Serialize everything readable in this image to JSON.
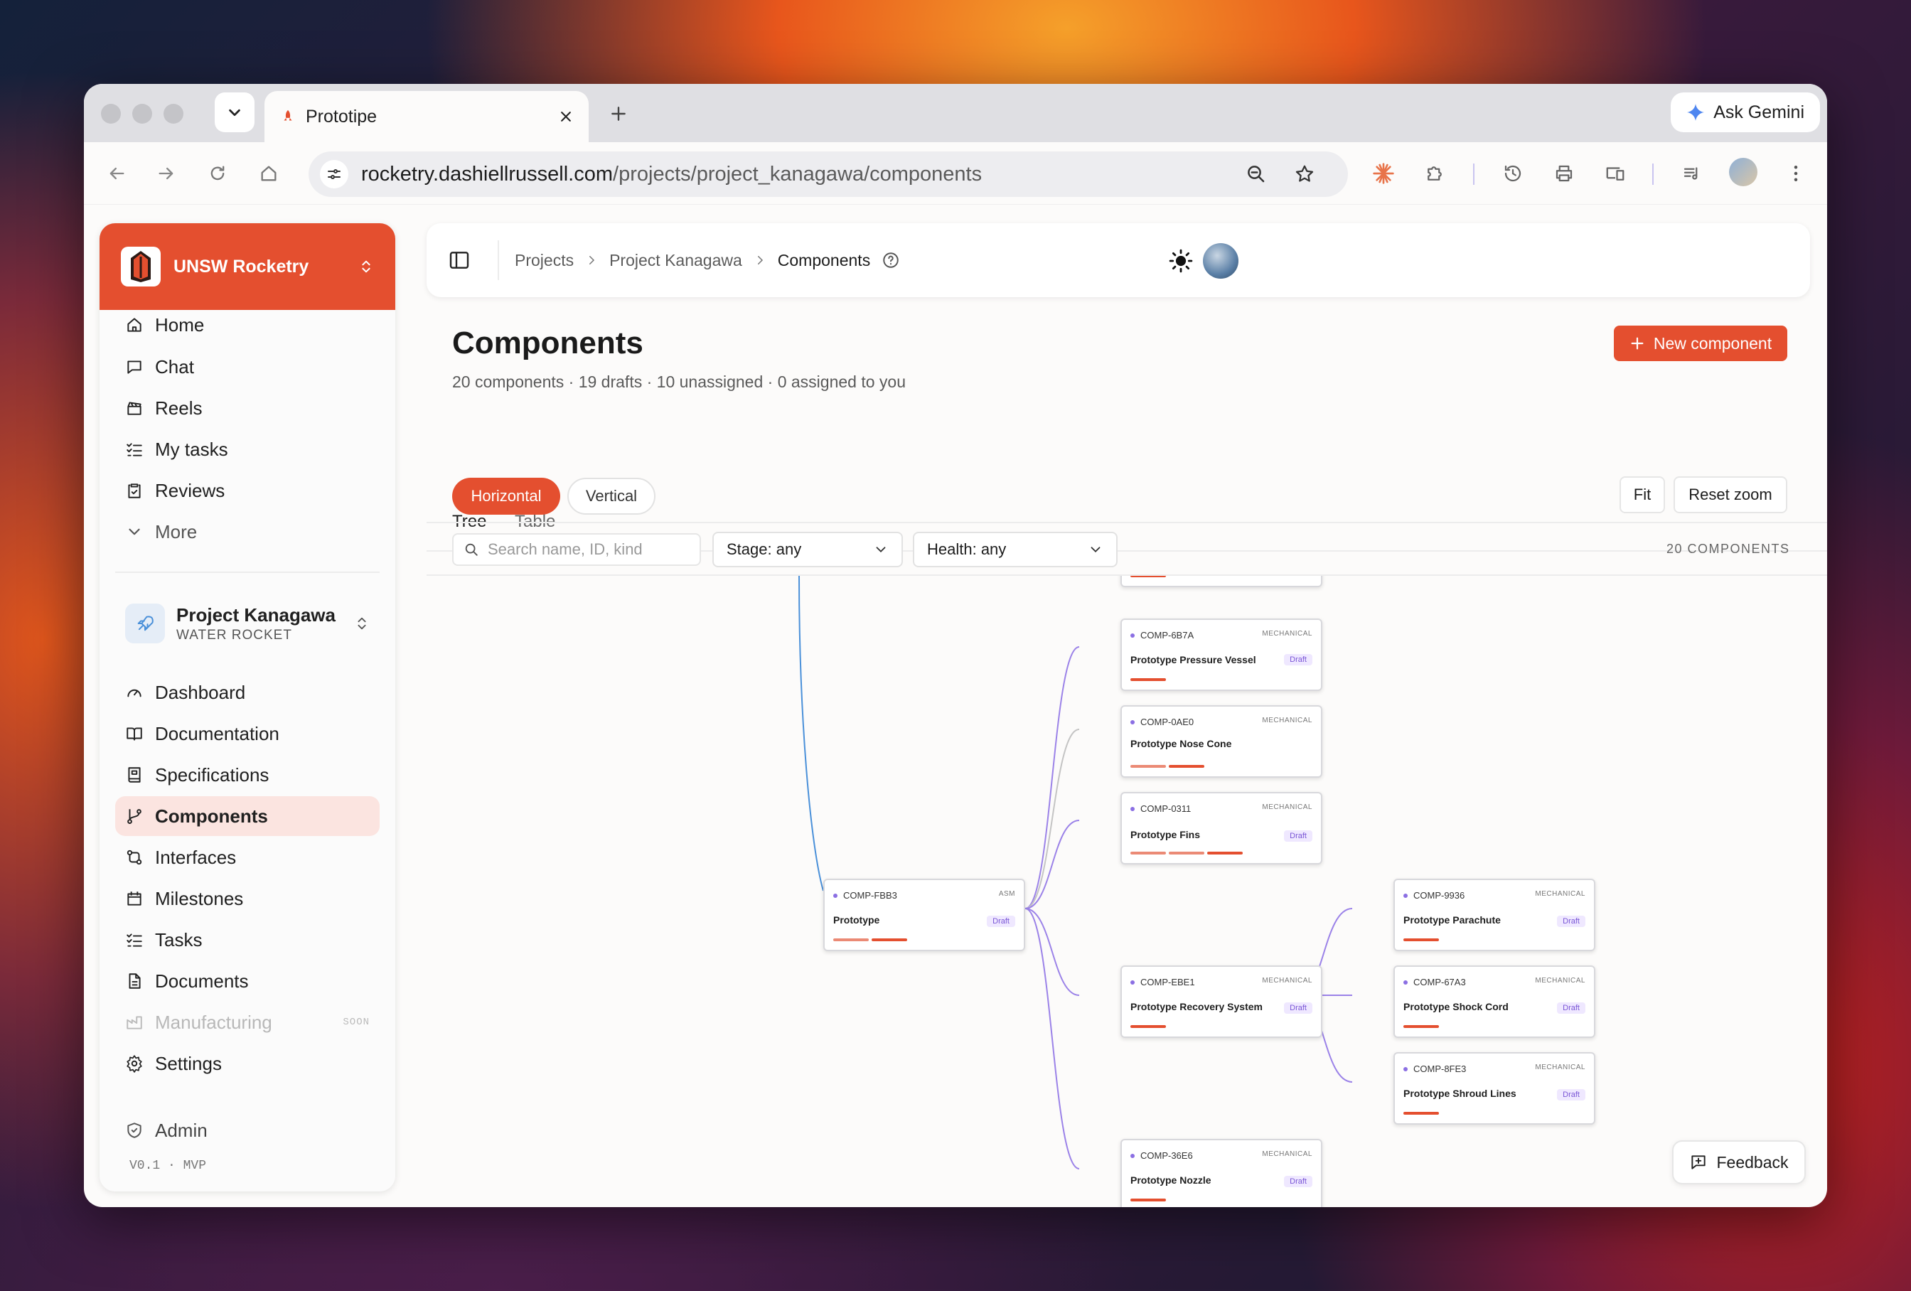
{
  "browser": {
    "tab_title": "Prototipe",
    "ask_gemini": "Ask Gemini",
    "url_host": "rocketry.dashiellrussell.com",
    "url_path": "/projects/project_kanagawa/components"
  },
  "sidebar": {
    "org_name": "UNSW Rocketry",
    "top_items": [
      {
        "label": "Home",
        "icon": "home-icon"
      },
      {
        "label": "Chat",
        "icon": "chat-icon"
      },
      {
        "label": "Reels",
        "icon": "clapperboard-icon"
      },
      {
        "label": "My tasks",
        "icon": "checklist-icon"
      },
      {
        "label": "Reviews",
        "icon": "clipboard-check-icon"
      },
      {
        "label": "More",
        "icon": "chevron-down-icon"
      }
    ],
    "project": {
      "name": "Project Kanagawa",
      "subtitle": "WATER ROCKET"
    },
    "project_items": [
      {
        "label": "Dashboard",
        "icon": "gauge-icon"
      },
      {
        "label": "Documentation",
        "icon": "book-icon"
      },
      {
        "label": "Specifications",
        "icon": "spec-book-icon"
      },
      {
        "label": "Components",
        "icon": "git-branch-icon",
        "active": true
      },
      {
        "label": "Interfaces",
        "icon": "link-icon"
      },
      {
        "label": "Milestones",
        "icon": "calendar-icon"
      },
      {
        "label": "Tasks",
        "icon": "checklist-icon"
      },
      {
        "label": "Documents",
        "icon": "file-icon"
      },
      {
        "label": "Manufacturing",
        "icon": "factory-icon",
        "disabled": true,
        "badge": "SOON"
      },
      {
        "label": "Settings",
        "icon": "gear-icon"
      }
    ],
    "admin_label": "Admin",
    "version": "V0.1 · MVP"
  },
  "breadcrumbs": [
    "Projects",
    "Project Kanagawa",
    "Components"
  ],
  "page": {
    "title": "Components",
    "summary": "20 components · 19 drafts · 10 unassigned · 0 assigned to you",
    "new_button": "New component",
    "tabs": [
      "Tree",
      "Table"
    ],
    "layouts": [
      "Horizontal",
      "Vertical"
    ],
    "fit_label": "Fit",
    "reset_zoom_label": "Reset zoom",
    "search_placeholder": "Search name, ID, kind",
    "stage_filter": "Stage: any",
    "health_filter": "Health: any",
    "count_label": "20 COMPONENTS",
    "feedback": "Feedback"
  },
  "tree_nodes": [
    {
      "id": "COMP-6B7A",
      "kind": "MECHANICAL",
      "name": "Prototype Pressure Vessel",
      "badge": "Draft"
    },
    {
      "id": "COMP-0AE0",
      "kind": "MECHANICAL",
      "name": "Prototype Nose Cone",
      "badge": ""
    },
    {
      "id": "COMP-0311",
      "kind": "MECHANICAL",
      "name": "Prototype Fins",
      "badge": "Draft"
    },
    {
      "id": "COMP-FBB3",
      "kind": "ASM",
      "name": "Prototype",
      "badge": "Draft"
    },
    {
      "id": "COMP-EBE1",
      "kind": "MECHANICAL",
      "name": "Prototype Recovery System",
      "badge": "Draft"
    },
    {
      "id": "COMP-36E6",
      "kind": "MECHANICAL",
      "name": "Prototype Nozzle",
      "badge": "Draft"
    },
    {
      "id": "COMP-9936",
      "kind": "MECHANICAL",
      "name": "Prototype Parachute",
      "badge": "Draft"
    },
    {
      "id": "COMP-67A3",
      "kind": "MECHANICAL",
      "name": "Prototype Shock Cord",
      "badge": "Draft"
    },
    {
      "id": "COMP-8FE3",
      "kind": "MECHANICAL",
      "name": "Prototype Shroud Lines",
      "badge": "Draft"
    }
  ],
  "colors": {
    "accent": "#e44f2f",
    "edge": "#9b82e8",
    "edge_alt": "#c4c4c4",
    "edge_blue": "#4a90d9",
    "draft_badge": "#efe8ff"
  }
}
